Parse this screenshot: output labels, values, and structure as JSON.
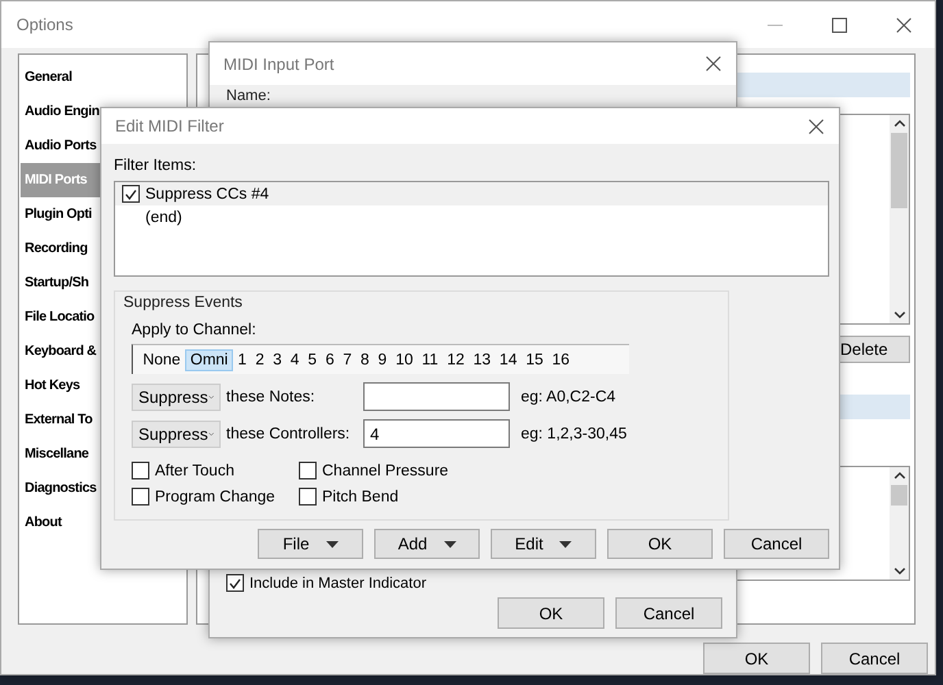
{
  "options_window": {
    "title": "Options",
    "sidebar": {
      "items": [
        {
          "label": "General",
          "selected": false
        },
        {
          "label": "Audio Engin",
          "selected": false
        },
        {
          "label": "Audio Ports",
          "selected": false
        },
        {
          "label": "MIDI Ports",
          "selected": true
        },
        {
          "label": "Plugin Opti",
          "selected": false
        },
        {
          "label": "Recording",
          "selected": false
        },
        {
          "label": "Startup/Sh",
          "selected": false
        },
        {
          "label": "File Locatio",
          "selected": false
        },
        {
          "label": "Keyboard &",
          "selected": false
        },
        {
          "label": "Hot Keys",
          "selected": false
        },
        {
          "label": "External To",
          "selected": false
        },
        {
          "label": "Miscellane",
          "selected": false
        },
        {
          "label": "Diagnostics",
          "selected": false
        },
        {
          "label": "About",
          "selected": false
        }
      ]
    },
    "delete_button": "Delete",
    "buttons": [
      "OK",
      "Cancel"
    ]
  },
  "midi_input_port": {
    "title": "MIDI Input Port",
    "name_label": "Name:",
    "include_master": {
      "label": "Include in Master Indicator",
      "checked": true
    },
    "buttons": [
      "OK",
      "Cancel"
    ]
  },
  "edit_midi_filter": {
    "title": "Edit MIDI Filter",
    "filter_items_label": "Filter Items:",
    "filter_items": [
      {
        "label": "Suppress CCs #4",
        "kind": "checkbox",
        "checked": true,
        "selected": true
      },
      {
        "label": "(end)",
        "kind": "plain",
        "selected": false
      }
    ],
    "suppress_events": {
      "title": "Suppress Events",
      "apply_label": "Apply to Channel:",
      "channels": [
        {
          "label": "None",
          "selected": false
        },
        {
          "label": "Omni",
          "selected": true
        },
        {
          "label": "1",
          "selected": false
        },
        {
          "label": "2",
          "selected": false
        },
        {
          "label": "3",
          "selected": false
        },
        {
          "label": "4",
          "selected": false
        },
        {
          "label": "5",
          "selected": false
        },
        {
          "label": "6",
          "selected": false
        },
        {
          "label": "7",
          "selected": false
        },
        {
          "label": "8",
          "selected": false
        },
        {
          "label": "9",
          "selected": false
        },
        {
          "label": "10",
          "selected": false
        },
        {
          "label": "11",
          "selected": false
        },
        {
          "label": "12",
          "selected": false
        },
        {
          "label": "13",
          "selected": false
        },
        {
          "label": "14",
          "selected": false
        },
        {
          "label": "15",
          "selected": false
        },
        {
          "label": "16",
          "selected": false
        }
      ],
      "rows": [
        {
          "action": "Suppress",
          "label": "these Notes:",
          "hint": "eg: A0,C2-C4"
        },
        {
          "action": "Suppress",
          "label": "these Controllers:",
          "value": "4",
          "hint": "eg: 1,2,3-30,45"
        }
      ],
      "checkboxes": [
        {
          "label": "After Touch",
          "checked": false
        },
        {
          "label": "Channel Pressure",
          "checked": false
        },
        {
          "label": "Program Change",
          "checked": false
        },
        {
          "label": "Pitch Bend",
          "checked": false
        }
      ]
    },
    "buttons": [
      {
        "label": "File",
        "dropdown": true
      },
      {
        "label": "Add",
        "dropdown": true
      },
      {
        "label": "Edit",
        "dropdown": true
      },
      {
        "label": "OK",
        "dropdown": false
      },
      {
        "label": "Cancel",
        "dropdown": false
      }
    ]
  }
}
